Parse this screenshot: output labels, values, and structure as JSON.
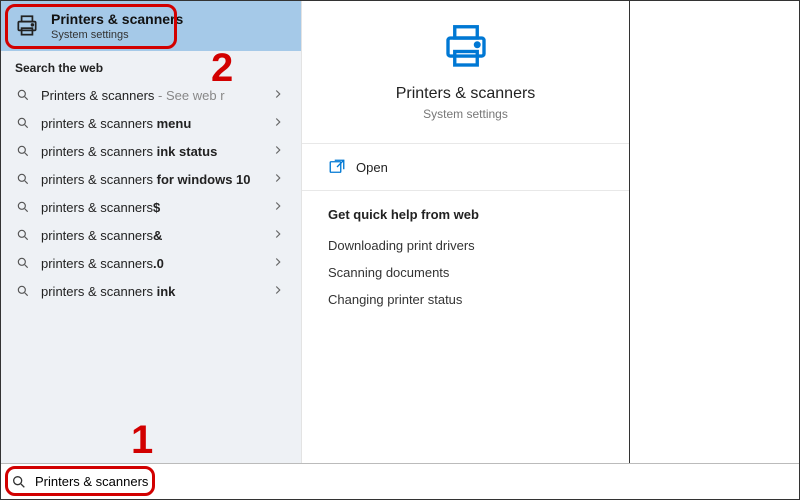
{
  "annotations": {
    "num1": "1",
    "num2": "2"
  },
  "top_match": {
    "title": "Printers & scanners",
    "subtitle": "System settings"
  },
  "web_header": "Search the web",
  "suggestions": [
    {
      "prefix": "Printers & scanners",
      "bold": "",
      "suffix": " - See web r"
    },
    {
      "prefix": "printers & scanners ",
      "bold": "menu",
      "suffix": ""
    },
    {
      "prefix": "printers & scanners ",
      "bold": "ink status",
      "suffix": ""
    },
    {
      "prefix": "printers & scanners ",
      "bold": "for windows 10",
      "suffix": ""
    },
    {
      "prefix": "printers & scanners",
      "bold": "$",
      "suffix": ""
    },
    {
      "prefix": "printers & scanners",
      "bold": "&",
      "suffix": ""
    },
    {
      "prefix": "printers & scanners",
      "bold": ".0",
      "suffix": ""
    },
    {
      "prefix": "printers & scanners ",
      "bold": "ink",
      "suffix": ""
    }
  ],
  "detail": {
    "title": "Printers & scanners",
    "subtitle": "System settings"
  },
  "open_label": "Open",
  "help": {
    "header": "Get quick help from web",
    "links": [
      "Downloading print drivers",
      "Scanning documents",
      "Changing printer status"
    ]
  },
  "search_value": "Printers & scanners"
}
